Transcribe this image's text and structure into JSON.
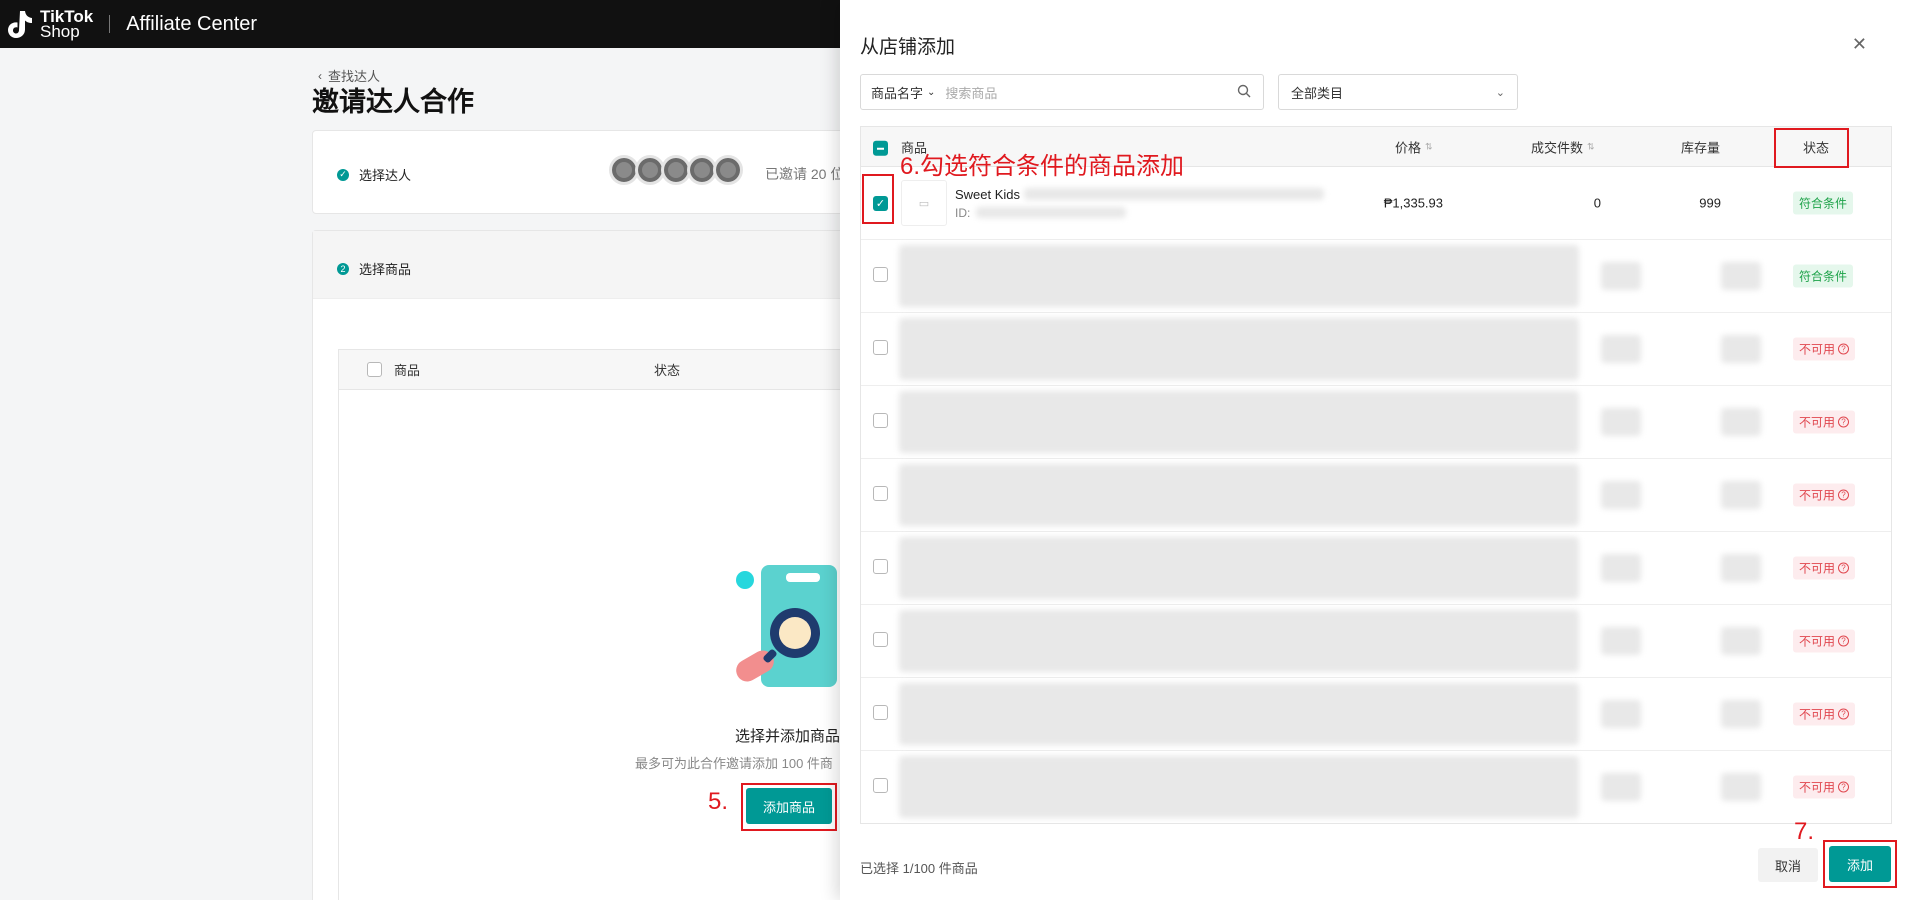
{
  "header": {
    "logo_line1": "TikTok",
    "logo_line2": "Shop",
    "app_title": "Affiliate Center"
  },
  "page": {
    "back_label": "查找达人",
    "title": "邀请达人合作",
    "step1": {
      "number": "",
      "label": "选择达人",
      "invited_text": "已邀请 20 位"
    },
    "step2": {
      "number": "2",
      "label": "选择商品"
    },
    "inner_table": {
      "col_product": "商品",
      "col_status": "状态"
    },
    "empty": {
      "title": "选择并添加商品",
      "subtitle": "最多可为此合作邀请添加 100 件商",
      "add_button": "添加商品"
    },
    "annotation_5": "5."
  },
  "modal": {
    "title": "从店铺添加",
    "close_icon": "close-icon",
    "search": {
      "type_label": "商品名字",
      "placeholder": "搜索商品"
    },
    "category": "全部类目",
    "columns": {
      "product": "商品",
      "price": "价格",
      "sold": "成交件数",
      "stock": "库存量",
      "status": "状态"
    },
    "rows": [
      {
        "name": "Sweet Kids",
        "id_label": "ID:",
        "price": "₱1,335.93",
        "sold": "0",
        "stock": "999",
        "status": "符合条件",
        "status_type": "ok",
        "checked": true
      },
      {
        "status": "符合条件",
        "status_type": "ok"
      },
      {
        "status": "不可用",
        "status_type": "no"
      },
      {
        "status": "不可用",
        "status_type": "no"
      },
      {
        "status": "不可用",
        "status_type": "no"
      },
      {
        "status": "不可用",
        "status_type": "no"
      },
      {
        "status": "不可用",
        "status_type": "no"
      },
      {
        "status": "不可用",
        "status_type": "no"
      },
      {
        "status": "不可用",
        "status_type": "no"
      }
    ],
    "annotation_6": "6.勾选符合条件的商品添加",
    "footer_text": "已选择 1/100 件商品",
    "cancel_button": "取消",
    "add_button": "添加",
    "annotation_7": "7."
  },
  "colors": {
    "primary": "#009995",
    "annotation": "#e0191f",
    "ok_text": "#1fa34a",
    "no_text": "#e0474f"
  }
}
